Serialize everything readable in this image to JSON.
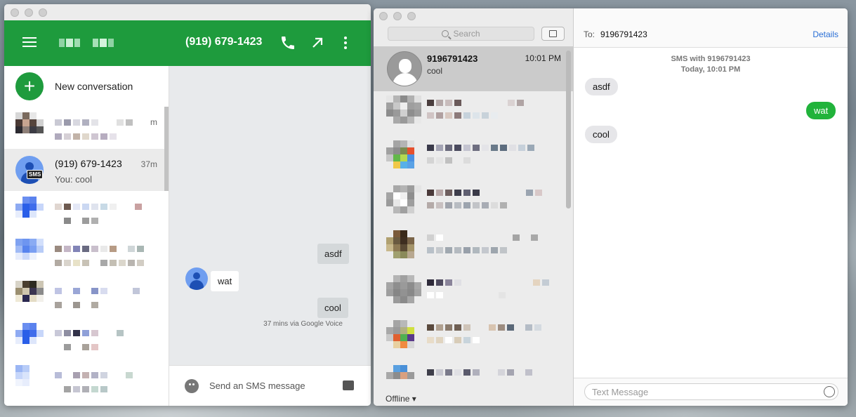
{
  "google_voice": {
    "header_title": "(919) 679-1423",
    "new_conversation": "New conversation",
    "active_conversation": {
      "name": "(919) 679-1423",
      "time": "37m",
      "snippet": "You: cool",
      "badge": "SMS"
    },
    "partial_time_1": "m",
    "thread": {
      "messages": [
        {
          "text": "asdf",
          "direction": "out"
        },
        {
          "text": "wat",
          "direction": "in"
        },
        {
          "text": "cool",
          "direction": "out"
        }
      ],
      "meta": "37 mins  via Google Voice"
    },
    "compose_placeholder": "Send an SMS message",
    "accent_color": "#1e9b3d",
    "icons": [
      "menu-icon",
      "phone-icon",
      "open-external-icon",
      "more-vert-icon",
      "plus-icon",
      "emoji-icon",
      "image-icon"
    ]
  },
  "messages_app": {
    "search_placeholder": "Search",
    "active_item": {
      "name": "9196791423",
      "time": "10:01 PM",
      "snippet": "cool"
    },
    "status": "Offline",
    "to_label": "To:",
    "to_value": "9196791423",
    "details_label": "Details",
    "thread_header": "SMS with 9196791423",
    "thread_date": "Today, 10:01 PM",
    "messages": [
      {
        "text": "asdf",
        "direction": "in"
      },
      {
        "text": "wat",
        "direction": "out"
      },
      {
        "text": "cool",
        "direction": "in"
      }
    ],
    "input_placeholder": "Text Message",
    "accent_color": "#21b33b",
    "icons": [
      "search-icon",
      "compose-icon",
      "emoji-icon"
    ]
  }
}
